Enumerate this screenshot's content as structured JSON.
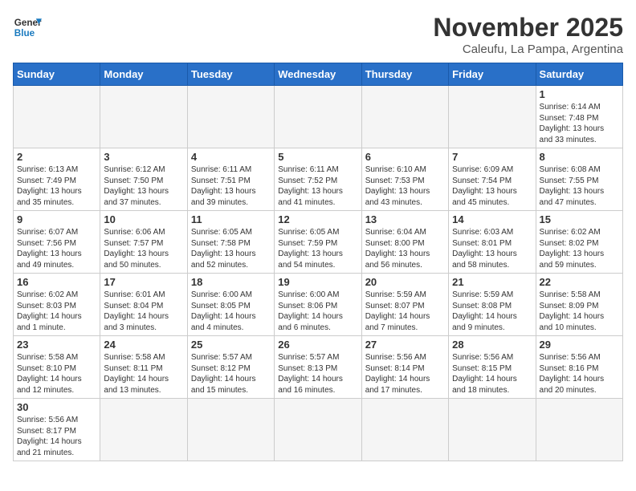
{
  "header": {
    "logo_general": "General",
    "logo_blue": "Blue",
    "month_title": "November 2025",
    "subtitle": "Caleufu, La Pampa, Argentina"
  },
  "days_of_week": [
    "Sunday",
    "Monday",
    "Tuesday",
    "Wednesday",
    "Thursday",
    "Friday",
    "Saturday"
  ],
  "weeks": [
    [
      {
        "day": "",
        "info": ""
      },
      {
        "day": "",
        "info": ""
      },
      {
        "day": "",
        "info": ""
      },
      {
        "day": "",
        "info": ""
      },
      {
        "day": "",
        "info": ""
      },
      {
        "day": "",
        "info": ""
      },
      {
        "day": "1",
        "info": "Sunrise: 6:14 AM\nSunset: 7:48 PM\nDaylight: 13 hours and 33 minutes."
      }
    ],
    [
      {
        "day": "2",
        "info": "Sunrise: 6:13 AM\nSunset: 7:49 PM\nDaylight: 13 hours and 35 minutes."
      },
      {
        "day": "3",
        "info": "Sunrise: 6:12 AM\nSunset: 7:50 PM\nDaylight: 13 hours and 37 minutes."
      },
      {
        "day": "4",
        "info": "Sunrise: 6:11 AM\nSunset: 7:51 PM\nDaylight: 13 hours and 39 minutes."
      },
      {
        "day": "5",
        "info": "Sunrise: 6:11 AM\nSunset: 7:52 PM\nDaylight: 13 hours and 41 minutes."
      },
      {
        "day": "6",
        "info": "Sunrise: 6:10 AM\nSunset: 7:53 PM\nDaylight: 13 hours and 43 minutes."
      },
      {
        "day": "7",
        "info": "Sunrise: 6:09 AM\nSunset: 7:54 PM\nDaylight: 13 hours and 45 minutes."
      },
      {
        "day": "8",
        "info": "Sunrise: 6:08 AM\nSunset: 7:55 PM\nDaylight: 13 hours and 47 minutes."
      }
    ],
    [
      {
        "day": "9",
        "info": "Sunrise: 6:07 AM\nSunset: 7:56 PM\nDaylight: 13 hours and 49 minutes."
      },
      {
        "day": "10",
        "info": "Sunrise: 6:06 AM\nSunset: 7:57 PM\nDaylight: 13 hours and 50 minutes."
      },
      {
        "day": "11",
        "info": "Sunrise: 6:05 AM\nSunset: 7:58 PM\nDaylight: 13 hours and 52 minutes."
      },
      {
        "day": "12",
        "info": "Sunrise: 6:05 AM\nSunset: 7:59 PM\nDaylight: 13 hours and 54 minutes."
      },
      {
        "day": "13",
        "info": "Sunrise: 6:04 AM\nSunset: 8:00 PM\nDaylight: 13 hours and 56 minutes."
      },
      {
        "day": "14",
        "info": "Sunrise: 6:03 AM\nSunset: 8:01 PM\nDaylight: 13 hours and 58 minutes."
      },
      {
        "day": "15",
        "info": "Sunrise: 6:02 AM\nSunset: 8:02 PM\nDaylight: 13 hours and 59 minutes."
      }
    ],
    [
      {
        "day": "16",
        "info": "Sunrise: 6:02 AM\nSunset: 8:03 PM\nDaylight: 14 hours and 1 minute."
      },
      {
        "day": "17",
        "info": "Sunrise: 6:01 AM\nSunset: 8:04 PM\nDaylight: 14 hours and 3 minutes."
      },
      {
        "day": "18",
        "info": "Sunrise: 6:00 AM\nSunset: 8:05 PM\nDaylight: 14 hours and 4 minutes."
      },
      {
        "day": "19",
        "info": "Sunrise: 6:00 AM\nSunset: 8:06 PM\nDaylight: 14 hours and 6 minutes."
      },
      {
        "day": "20",
        "info": "Sunrise: 5:59 AM\nSunset: 8:07 PM\nDaylight: 14 hours and 7 minutes."
      },
      {
        "day": "21",
        "info": "Sunrise: 5:59 AM\nSunset: 8:08 PM\nDaylight: 14 hours and 9 minutes."
      },
      {
        "day": "22",
        "info": "Sunrise: 5:58 AM\nSunset: 8:09 PM\nDaylight: 14 hours and 10 minutes."
      }
    ],
    [
      {
        "day": "23",
        "info": "Sunrise: 5:58 AM\nSunset: 8:10 PM\nDaylight: 14 hours and 12 minutes."
      },
      {
        "day": "24",
        "info": "Sunrise: 5:58 AM\nSunset: 8:11 PM\nDaylight: 14 hours and 13 minutes."
      },
      {
        "day": "25",
        "info": "Sunrise: 5:57 AM\nSunset: 8:12 PM\nDaylight: 14 hours and 15 minutes."
      },
      {
        "day": "26",
        "info": "Sunrise: 5:57 AM\nSunset: 8:13 PM\nDaylight: 14 hours and 16 minutes."
      },
      {
        "day": "27",
        "info": "Sunrise: 5:56 AM\nSunset: 8:14 PM\nDaylight: 14 hours and 17 minutes."
      },
      {
        "day": "28",
        "info": "Sunrise: 5:56 AM\nSunset: 8:15 PM\nDaylight: 14 hours and 18 minutes."
      },
      {
        "day": "29",
        "info": "Sunrise: 5:56 AM\nSunset: 8:16 PM\nDaylight: 14 hours and 20 minutes."
      }
    ],
    [
      {
        "day": "30",
        "info": "Sunrise: 5:56 AM\nSunset: 8:17 PM\nDaylight: 14 hours and 21 minutes."
      },
      {
        "day": "",
        "info": ""
      },
      {
        "day": "",
        "info": ""
      },
      {
        "day": "",
        "info": ""
      },
      {
        "day": "",
        "info": ""
      },
      {
        "day": "",
        "info": ""
      },
      {
        "day": "",
        "info": ""
      }
    ]
  ]
}
